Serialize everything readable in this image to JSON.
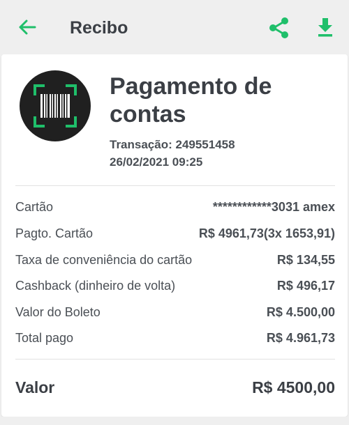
{
  "header": {
    "title": "Recibo",
    "back_icon": "arrow-left-icon",
    "share_icon": "share-icon",
    "download_icon": "download-icon",
    "accent_color": "#1fbf6a"
  },
  "receipt": {
    "logo_icon": "barcode-scan-icon",
    "heading": "Pagamento de contas",
    "transaction": "Transação: 249551458",
    "datetime": "26/02/2021 09:25",
    "rows": [
      {
        "label": "Cartão",
        "value": "************3031 amex"
      },
      {
        "label": "Pagto. Cartão",
        "value": "R$ 4961,73(3x 1653,91)"
      },
      {
        "label": "Taxa de conveniência do cartão",
        "value": "R$ 134,55"
      },
      {
        "label": "Cashback (dinheiro de volta)",
        "value": "R$ 496,17"
      },
      {
        "label": "Valor do Boleto",
        "value": "R$ 4.500,00"
      },
      {
        "label": "Total pago",
        "value": "R$ 4.961,73"
      }
    ],
    "total_label": "Valor",
    "total_value": "R$ 4500,00"
  }
}
